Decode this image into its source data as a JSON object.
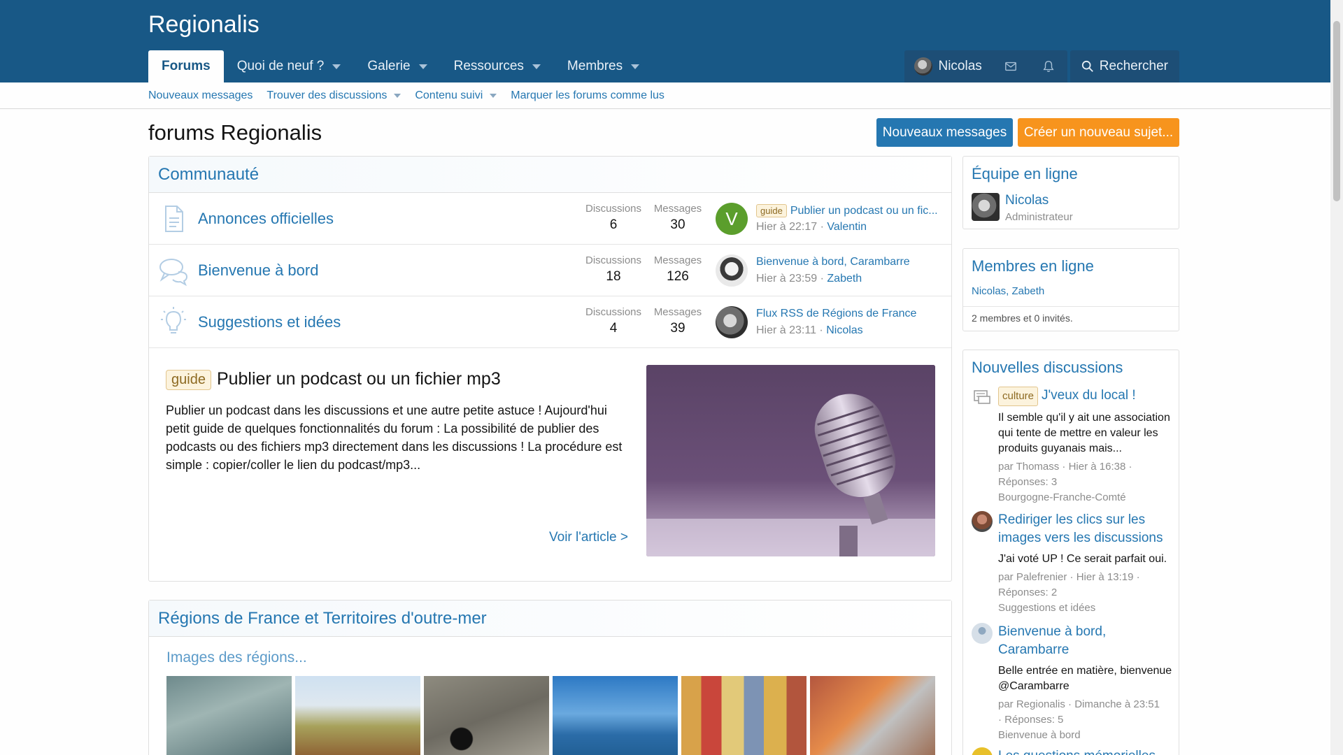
{
  "header": {
    "logo": "Regionalis",
    "nav": [
      {
        "label": "Forums",
        "active": true,
        "has_menu": false
      },
      {
        "label": "Quoi de neuf ?",
        "active": false,
        "has_menu": true
      },
      {
        "label": "Galerie",
        "active": false,
        "has_menu": true
      },
      {
        "label": "Ressources",
        "active": false,
        "has_menu": true
      },
      {
        "label": "Membres",
        "active": false,
        "has_menu": true
      }
    ],
    "user_name": "Nicolas",
    "search_label": "Rechercher"
  },
  "subnav": {
    "new_posts": "Nouveaux messages",
    "find_threads": "Trouver des discussions",
    "watched": "Contenu suivi",
    "mark_read": "Marquer les forums comme lus"
  },
  "page": {
    "title": "forums Regionalis",
    "btn_new_posts": "Nouveaux messages",
    "btn_new_thread": "Créer un nouveau sujet..."
  },
  "community": {
    "title": "Communauté",
    "stat_labels": {
      "discussions": "Discussions",
      "messages": "Messages"
    },
    "nodes": [
      {
        "title": "Annonces officielles",
        "discussions": "6",
        "messages": "30",
        "prefix": "guide",
        "last_title": "Publier un podcast ou un fic...",
        "last_date": "Hier à 22:17",
        "last_user": "Valentin",
        "avatar_letter": "V"
      },
      {
        "title": "Bienvenue à bord",
        "discussions": "18",
        "messages": "126",
        "prefix": "",
        "last_title": "Bienvenue à bord, Carambarre",
        "last_date": "Hier à 23:59",
        "last_user": "Zabeth",
        "avatar_letter": ""
      },
      {
        "title": "Suggestions et idées",
        "discussions": "4",
        "messages": "39",
        "prefix": "",
        "last_title": "Flux RSS de Régions de France",
        "last_date": "Hier à 23:11",
        "last_user": "Nicolas",
        "avatar_letter": ""
      }
    ]
  },
  "featured": {
    "prefix": "guide",
    "title": "Publier un podcast ou un fichier mp3",
    "text": "Publier un podcast dans les discussions et une autre petite astuce ! Aujourd'hui petit guide de quelques fonctionnalités du forum : La possibilité de publier des podcasts ou des fichiers mp3 directement dans les discussions ! La procédure est simple : copier/coller le lien du podcast/mp3...",
    "link": "Voir l'article >"
  },
  "regions": {
    "title": "Régions de France et Territoires d'outre-mer",
    "gallery_title": "Images des régions..."
  },
  "sidebar": {
    "staff": {
      "title": "Équipe en ligne",
      "name": "Nicolas",
      "role": "Administrateur"
    },
    "online": {
      "title": "Membres en ligne",
      "members": "Nicolas, Zabeth",
      "count": "2 membres et 0 invités."
    },
    "new_threads": {
      "title": "Nouvelles discussions",
      "threads": [
        {
          "prefix": "culture",
          "title": "J'veux du local !",
          "snippet": "Il semble qu'il y ait une association qui tente de mettre en valeur les produits guyanais mais...",
          "meta1": "par Thomass · Hier à 16:38 ·",
          "meta2": "Réponses: 3",
          "meta3": "Bourgogne-Franche-Comté"
        },
        {
          "prefix": "",
          "title": "Rediriger les clics sur les images vers les discussions",
          "snippet": "J'ai voté UP ! Ce serait parfait oui.",
          "meta1": "par Palefrenier · Hier à 13:19 ·",
          "meta2": "Réponses: 2",
          "meta3": "Suggestions et idées"
        },
        {
          "prefix": "",
          "title": "Bienvenue à bord, Carambarre",
          "snippet": "Belle entrée en matière, bienvenue @Carambarre",
          "meta1": "par Regionalis · Dimanche à 23:51",
          "meta2": "· Réponses: 5",
          "meta3": "Bienvenue à bord"
        },
        {
          "prefix": "",
          "title": "Les questions mémorielles",
          "snippet": "",
          "meta1": "",
          "meta2": "",
          "meta3": ""
        }
      ]
    }
  },
  "colors": {
    "brand": "#185886",
    "link": "#2577b1",
    "cta": "#f7941d",
    "prefix_bg": "#fcf3dd"
  }
}
